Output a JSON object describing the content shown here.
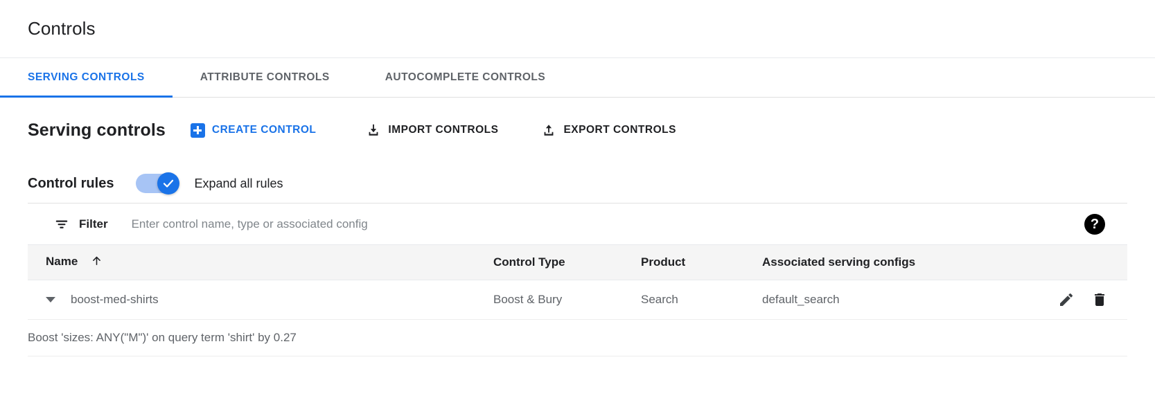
{
  "page": {
    "title": "Controls"
  },
  "tabs": [
    {
      "label": "SERVING CONTROLS",
      "active": true
    },
    {
      "label": "ATTRIBUTE CONTROLS",
      "active": false
    },
    {
      "label": "AUTOCOMPLETE CONTROLS",
      "active": false
    }
  ],
  "section": {
    "title": "Serving controls",
    "create_button": "CREATE CONTROL",
    "import_button": "IMPORT CONTROLS",
    "export_button": "EXPORT CONTROLS"
  },
  "rules": {
    "title": "Control rules",
    "toggle_label": "Expand all rules",
    "toggle_on": true
  },
  "filter": {
    "label": "Filter",
    "placeholder": "Enter control name, type or associated config",
    "value": "",
    "help_glyph": "?"
  },
  "table": {
    "columns": {
      "name": "Name",
      "control_type": "Control Type",
      "product": "Product",
      "associated": "Associated serving configs"
    },
    "sort": {
      "column": "Name",
      "direction": "asc",
      "glyph": "↑"
    },
    "rows": [
      {
        "name": "boost-med-shirts",
        "control_type": "Boost & Bury",
        "product": "Search",
        "associated_serving_configs": "default_search",
        "expanded": true,
        "detail": "Boost 'sizes: ANY(\"M\")' on query term 'shirt' by 0.27"
      }
    ]
  },
  "colors": {
    "accent": "#1a73e8",
    "text_primary": "#202124",
    "text_secondary": "#5f6368",
    "header_bg": "#f5f5f5",
    "toggle_track": "#a7c4f5"
  }
}
